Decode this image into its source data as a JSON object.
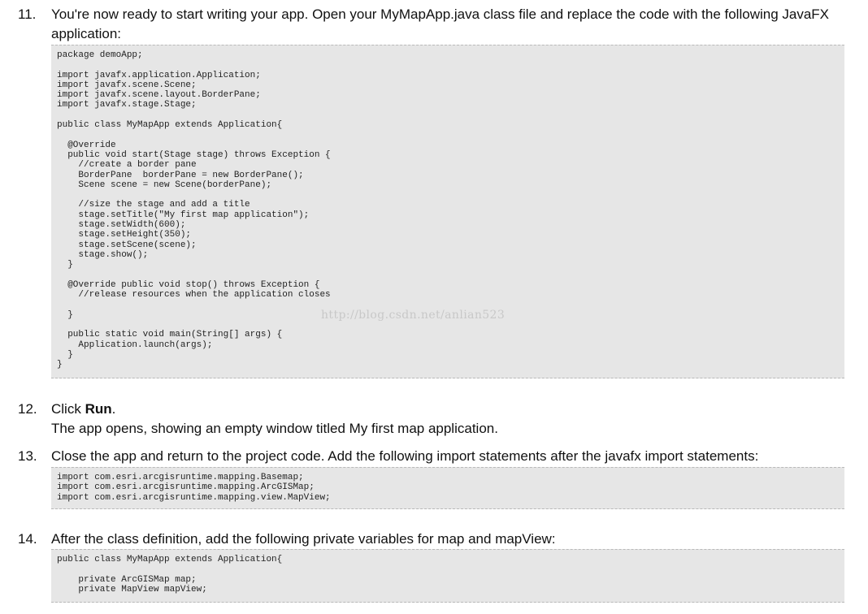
{
  "steps": [
    {
      "number": "11.",
      "text": "You're now ready to start writing your app. Open your MyMapApp.java class file and replace the code with the following JavaFX application:",
      "code": "package demoApp;\n\nimport javafx.application.Application;\nimport javafx.scene.Scene;\nimport javafx.scene.layout.BorderPane;\nimport javafx.stage.Stage;\n\npublic class MyMapApp extends Application{\n\n  @Override\n  public void start(Stage stage) throws Exception {\n    //create a border pane\n    BorderPane  borderPane = new BorderPane();\n    Scene scene = new Scene(borderPane);\n\n    //size the stage and add a title\n    stage.setTitle(\"My first map application\");\n    stage.setWidth(600);\n    stage.setHeight(350);\n    stage.setScene(scene);\n    stage.show();\n  }\n\n  @Override public void stop() throws Exception {\n    //release resources when the application closes\n\n  }\n\n  public static void main(String[] args) {\n    Application.launch(args);\n  }\n}"
    },
    {
      "number": "12.",
      "text_prefix": "Click ",
      "text_bold": "Run",
      "text_suffix": ".",
      "text2": "The app opens, showing an empty window titled My first map application."
    },
    {
      "number": "13.",
      "text": "Close the app and return to the project code. Add the following import statements after the javafx import statements:",
      "code": "import com.esri.arcgisruntime.mapping.Basemap;\nimport com.esri.arcgisruntime.mapping.ArcGISMap;\nimport com.esri.arcgisruntime.mapping.view.MapView;"
    },
    {
      "number": "14.",
      "text": "After the class definition, add the following private variables for map and mapView:",
      "code": "public class MyMapApp extends Application{\n\n    private ArcGISMap map;\n    private MapView mapView;"
    }
  ],
  "watermark": "http://blog.csdn.net/anlian523"
}
